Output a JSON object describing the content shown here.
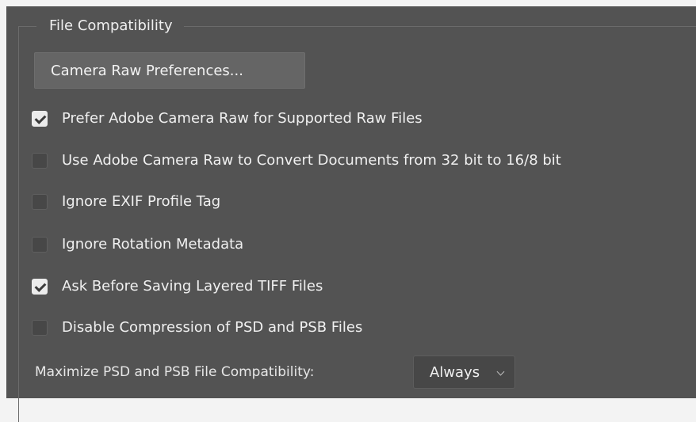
{
  "group": {
    "title": "File Compatibility"
  },
  "camera_raw_button": {
    "label": "Camera Raw Preferences..."
  },
  "options": [
    {
      "label": "Prefer Adobe Camera Raw for Supported Raw Files",
      "checked": true
    },
    {
      "label": "Use Adobe Camera Raw to Convert Documents from 32 bit to 16/8 bit",
      "checked": false
    },
    {
      "label": "Ignore EXIF Profile Tag",
      "checked": false
    },
    {
      "label": "Ignore Rotation Metadata",
      "checked": false
    },
    {
      "label": "Ask Before Saving Layered TIFF Files",
      "checked": true
    },
    {
      "label": "Disable Compression of PSD and PSB Files",
      "checked": false
    }
  ],
  "maximize": {
    "label": "Maximize PSD and PSB File Compatibility:",
    "selected": "Always"
  },
  "colors": {
    "panel_bg": "#535353",
    "outer_bg": "#f3f3f3",
    "text": "#f0f0f0",
    "checkbox_checked": "#ececec"
  }
}
